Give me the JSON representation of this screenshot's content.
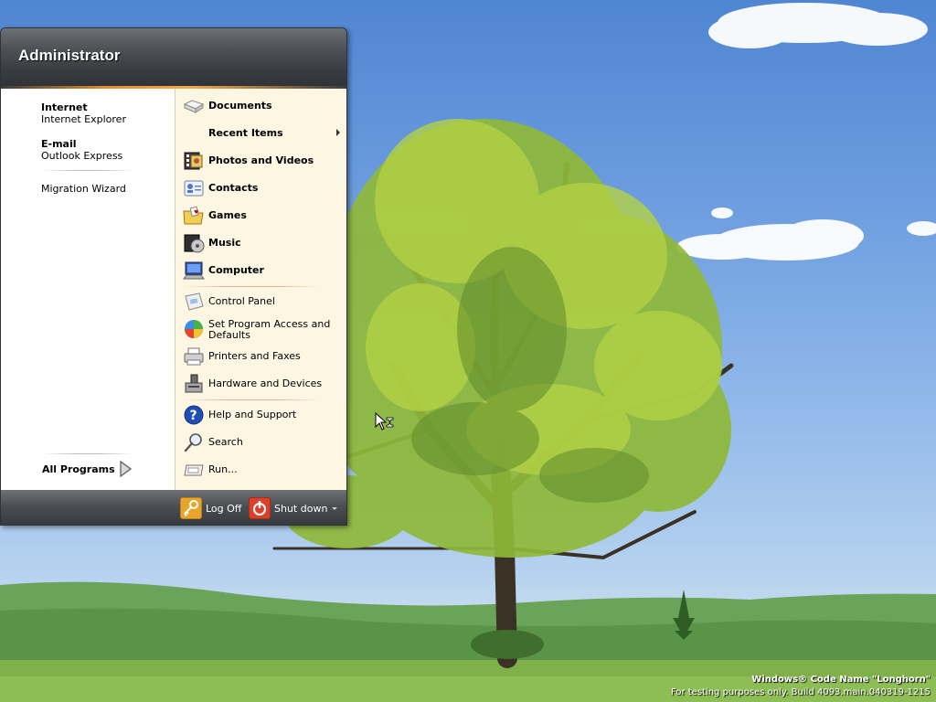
{
  "start_menu": {
    "user_name": "Administrator",
    "pinned": [
      {
        "title": "Internet",
        "subtitle": "Internet Explorer"
      },
      {
        "title": "E-mail",
        "subtitle": "Outlook Express"
      }
    ],
    "recent": [
      {
        "label": "Migration Wizard"
      }
    ],
    "all_programs_label": "All Programs",
    "right_items": [
      {
        "label": "Documents",
        "icon": "documents-icon"
      },
      {
        "label": "Recent Items",
        "icon": "recent-items-icon"
      },
      {
        "label": "Photos and Videos",
        "icon": "photos-videos-icon"
      },
      {
        "label": "Contacts",
        "icon": "contacts-icon"
      },
      {
        "label": "Games",
        "icon": "games-icon"
      },
      {
        "label": "Music",
        "icon": "music-icon"
      },
      {
        "label": "Computer",
        "icon": "computer-icon"
      },
      {
        "label": "Control Panel",
        "icon": "control-panel-icon"
      },
      {
        "label": "Set Program Access and Defaults",
        "icon": "program-access-icon"
      },
      {
        "label": "Printers and Faxes",
        "icon": "printer-icon"
      },
      {
        "label": "Hardware and Devices",
        "icon": "hardware-icon"
      },
      {
        "label": "Help and Support",
        "icon": "help-icon"
      },
      {
        "label": "Search",
        "icon": "search-icon"
      },
      {
        "label": "Run...",
        "icon": "run-icon"
      }
    ],
    "footer": {
      "log_off_label": "Log Off",
      "shut_down_label": "Shut down"
    }
  },
  "watermark": {
    "title": "Windows® Code Name \"Longhorn\"",
    "subtitle": "For testing purposes only. Build 4093.main.040319-1215"
  },
  "colors": {
    "header_dark": "#3a3d41",
    "accent_orange": "#f6a64a",
    "right_pane_bg": "#fcf6e3",
    "sky_blue": "#6e9ee0",
    "grass_green": "#5f9e3c"
  }
}
